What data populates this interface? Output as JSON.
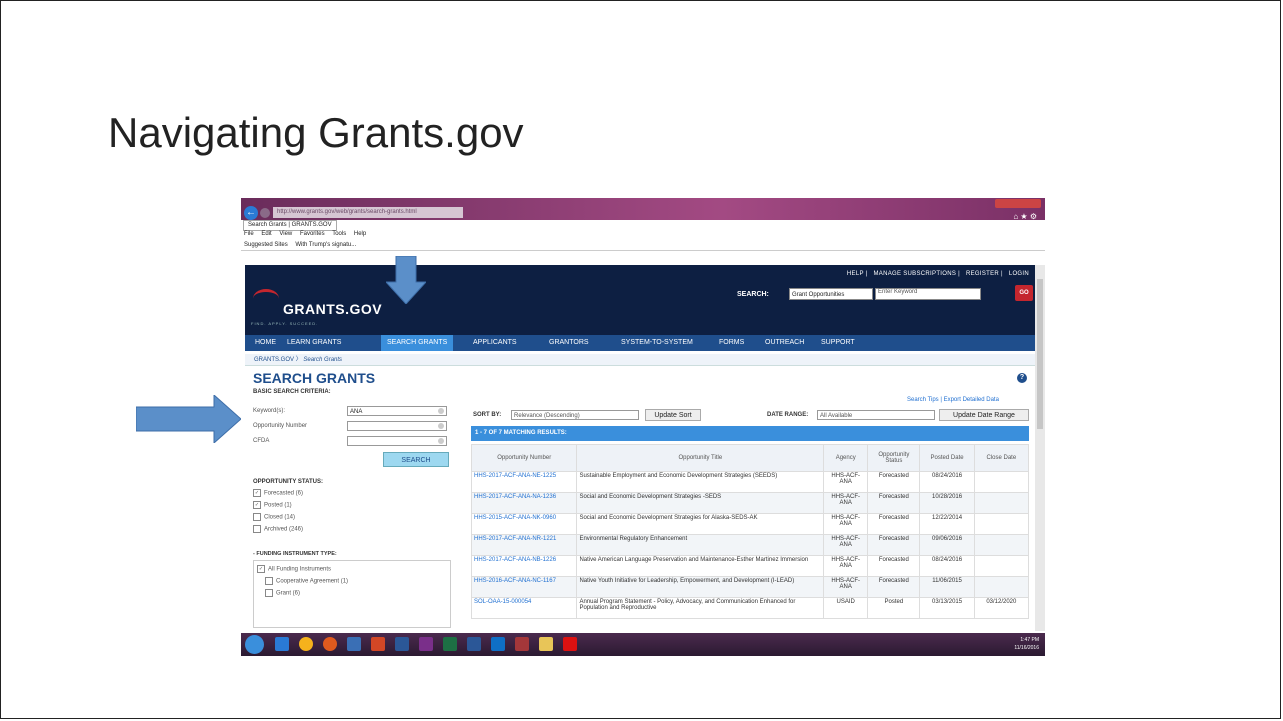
{
  "slide": {
    "title": "Navigating Grants.gov"
  },
  "browser": {
    "address": "http://www.grants.gov/web/grants/search-grants.html",
    "tab_label": "Search Grants | GRANTS.GOV",
    "menu": [
      "File",
      "Edit",
      "View",
      "Favorites",
      "Tools",
      "Help"
    ],
    "favorites": [
      "Suggested Sites",
      "With Trump's signatu..."
    ]
  },
  "site": {
    "top_links": [
      "HELP",
      "MANAGE SUBSCRIPTIONS",
      "REGISTER",
      "LOGIN"
    ],
    "logo": "GRANTS.GOV",
    "tagline": "FIND. APPLY. SUCCEED.",
    "search_label": "SEARCH:",
    "search_select": "Grant Opportunities",
    "search_placeholder": "Enter Keyword",
    "go_label": "GO",
    "nav": [
      "HOME",
      "LEARN GRANTS",
      "SEARCH GRANTS",
      "APPLICANTS",
      "GRANTORS",
      "SYSTEM-TO-SYSTEM",
      "FORMS",
      "OUTREACH",
      "SUPPORT"
    ],
    "breadcrumb": [
      "GRANTS.GOV",
      "Search Grants"
    ]
  },
  "search": {
    "heading": "SEARCH GRANTS",
    "basic_label": "BASIC SEARCH CRITERIA:",
    "keyword_label": "Keyword(s):",
    "keyword_value": "ANA",
    "opp_label": "Opportunity Number",
    "opp_value": "",
    "cfda_label": "CFDA",
    "cfda_value": "",
    "button": "SEARCH",
    "status_heading": "OPPORTUNITY STATUS:",
    "status": [
      {
        "label": "Forecasted (6)",
        "checked": true
      },
      {
        "label": "Posted (1)",
        "checked": true
      },
      {
        "label": "Closed (14)",
        "checked": false
      },
      {
        "label": "Archived (246)",
        "checked": false
      }
    ],
    "fit_heading": "- FUNDING INSTRUMENT TYPE:",
    "fit": [
      {
        "label": "All Funding Instruments",
        "checked": true,
        "indent": false
      },
      {
        "label": "Cooperative Agreement (1)",
        "checked": false,
        "indent": true
      },
      {
        "label": "Grant (6)",
        "checked": false,
        "indent": true
      }
    ]
  },
  "results": {
    "sort_label": "SORT BY:",
    "sort_value": "Relevance (Descending)",
    "update_sort": "Update Sort",
    "date_label": "DATE RANGE:",
    "date_value": "All Available",
    "update_date": "Update Date Range",
    "links": "Search Tips | Export Detailed Data",
    "count": "1 - 7 OF 7 MATCHING RESULTS:",
    "columns": [
      "Opportunity Number",
      "Opportunity Title",
      "Agency",
      "Opportunity Status",
      "Posted Date",
      "Close Date"
    ],
    "rows": [
      [
        "HHS-2017-ACF-ANA-NE-1225",
        "Sustainable Employment and Economic Development Strategies (SEEDS)",
        "HHS-ACF-ANA",
        "Forecasted",
        "08/24/2016",
        ""
      ],
      [
        "HHS-2017-ACF-ANA-NA-1236",
        "Social and Economic Development Strategies -SEDS",
        "HHS-ACF-ANA",
        "Forecasted",
        "10/28/2016",
        ""
      ],
      [
        "HHS-2015-ACF-ANA-NK-0960",
        "Social and Economic Development Strategies for Alaska-SEDS-AK",
        "HHS-ACF-ANA",
        "Forecasted",
        "12/22/2014",
        ""
      ],
      [
        "HHS-2017-ACF-ANA-NR-1221",
        "Environmental Regulatory Enhancement",
        "HHS-ACF-ANA",
        "Forecasted",
        "09/06/2016",
        ""
      ],
      [
        "HHS-2017-ACF-ANA-NB-1226",
        "Native American Language Preservation and Maintenance-Esther Martinez Immersion",
        "HHS-ACF-ANA",
        "Forecasted",
        "08/24/2016",
        ""
      ],
      [
        "HHS-2016-ACF-ANA-NC-1167",
        "Native Youth Initiative for Leadership, Empowerment, and Development (I-LEAD)",
        "HHS-ACF-ANA",
        "Forecasted",
        "11/06/2015",
        ""
      ],
      [
        "SOL-OAA-15-000054",
        "Annual Program Statement - Policy, Advocacy, and Communication Enhanced for Population and Reproductive",
        "USAID",
        "Posted",
        "03/13/2015",
        "03/12/2020"
      ]
    ]
  },
  "taskbar": {
    "time": "1:47 PM",
    "date": "11/16/2016"
  }
}
